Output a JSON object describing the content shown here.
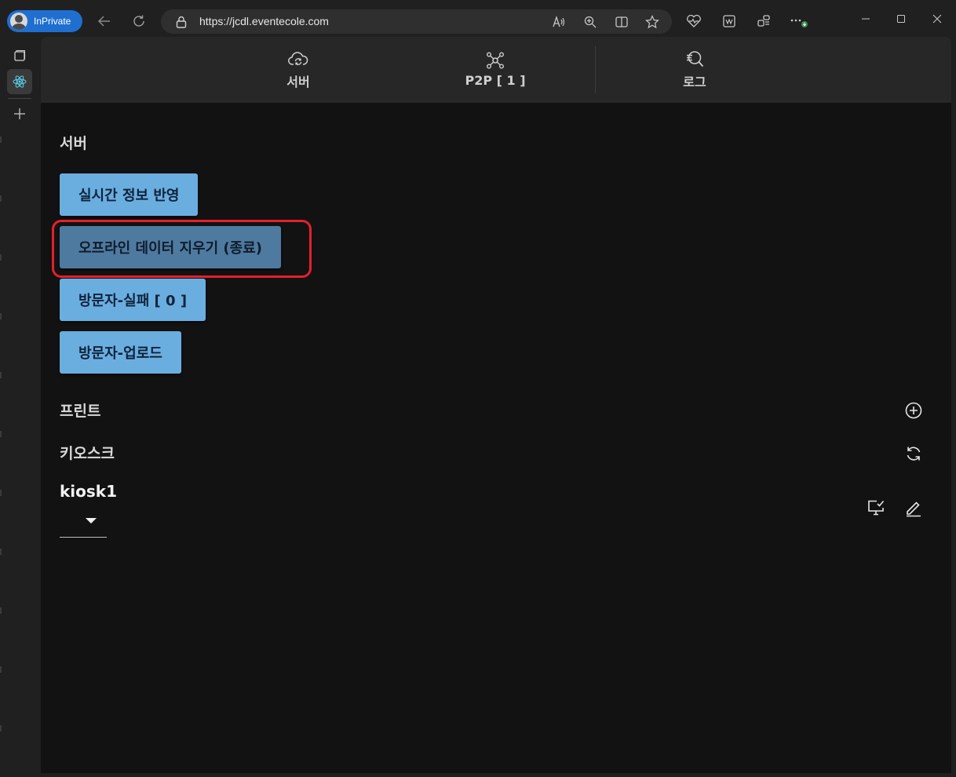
{
  "browser": {
    "inprivate_label": "InPrivate",
    "url": "https://jcdl.eventecole.com"
  },
  "tabs": [
    {
      "label": "서버",
      "icon": "cloud-sync-icon"
    },
    {
      "label": "P2P [ 1 ]",
      "icon": "network-nodes-icon"
    },
    {
      "label": "로그",
      "icon": "log-search-icon"
    }
  ],
  "server": {
    "title": "서버",
    "buttons": [
      {
        "label": "실시간 정보 반영"
      },
      {
        "label": "오프라인 데이터 지우기 (종료)"
      },
      {
        "label": "방문자-실패 [ 0 ]"
      },
      {
        "label": "방문자-업로드"
      }
    ]
  },
  "print": {
    "title": "프린트",
    "action_icon": "add-circle-icon"
  },
  "kiosk": {
    "title": "키오스크",
    "action_icon": "refresh-icon",
    "selected": "kiosk1",
    "item_icons": [
      "monitor-check-icon",
      "edit-pencil-icon"
    ]
  },
  "colors": {
    "button": "#6aaee0",
    "button_pressed": "#4f7a9f",
    "highlight": "#e5202b",
    "page_bg": "#121212",
    "tabbar_bg": "#272727"
  }
}
